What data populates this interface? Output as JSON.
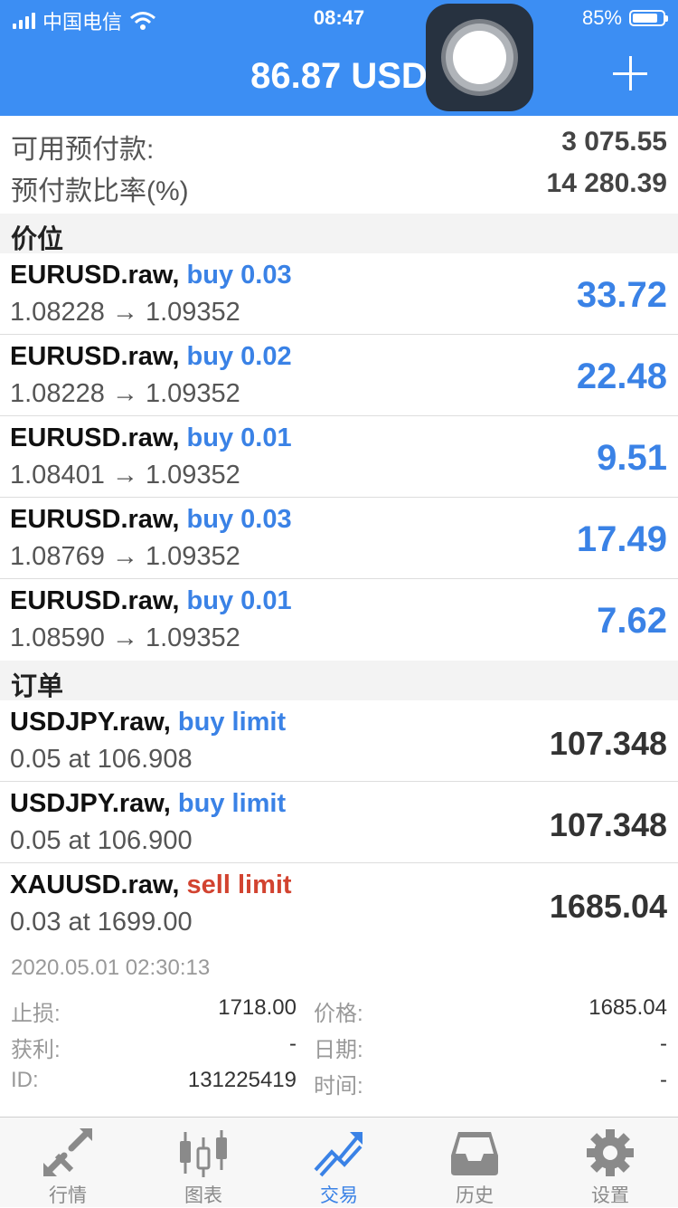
{
  "status_bar": {
    "carrier": "中国电信",
    "time": "08:47",
    "battery": "85%",
    "battery_level": 0.85
  },
  "header": {
    "title": "86.87 USD"
  },
  "summary": [
    {
      "label": "可用预付款:",
      "value": "3 075.55"
    },
    {
      "label": "预付款比率(%)",
      "value": "14 280.39"
    }
  ],
  "positions_header": "价位",
  "positions": [
    {
      "symbol": "EURUSD.raw,",
      "action": "buy 0.03",
      "prices": "1.08228 → 1.09352",
      "profit": "33.72"
    },
    {
      "symbol": "EURUSD.raw,",
      "action": "buy 0.02",
      "prices": "1.08228 → 1.09352",
      "profit": "22.48"
    },
    {
      "symbol": "EURUSD.raw,",
      "action": "buy 0.01",
      "prices": "1.08401 → 1.09352",
      "profit": "9.51"
    },
    {
      "symbol": "EURUSD.raw,",
      "action": "buy 0.03",
      "prices": "1.08769 → 1.09352",
      "profit": "17.49"
    },
    {
      "symbol": "EURUSD.raw,",
      "action": "buy 0.01",
      "prices": "1.08590 → 1.09352",
      "profit": "7.62"
    }
  ],
  "orders_header": "订单",
  "orders": [
    {
      "symbol": "USDJPY.raw,",
      "action": "buy limit",
      "detail": "0.05 at 106.908",
      "price": "107.348"
    },
    {
      "symbol": "USDJPY.raw,",
      "action": "buy limit",
      "detail": "0.05 at 106.900",
      "price": "107.348"
    },
    {
      "symbol": "XAUUSD.raw,",
      "action": "sell limit",
      "detail": "0.03 at 1699.00",
      "price": "1685.04"
    }
  ],
  "order_detail": {
    "timestamp": "2020.05.01 02:30:13",
    "stop_loss_label": "止损:",
    "stop_loss_value": "1718.00",
    "price_label": "价格:",
    "price_value": "1685.04",
    "take_profit_label": "获利:",
    "take_profit_value": "-",
    "date_label": "日期:",
    "date_value": "-",
    "id_label": "ID:",
    "id_value": "131225419",
    "time_label": "时间:",
    "time_value": "-"
  },
  "tabs": [
    {
      "label": "行情",
      "icon": "quotes-arrows-icon"
    },
    {
      "label": "图表",
      "icon": "candlestick-chart-icon"
    },
    {
      "label": "交易",
      "icon": "trade-trend-icon",
      "active": true
    },
    {
      "label": "历史",
      "icon": "history-inbox-icon"
    },
    {
      "label": "设置",
      "icon": "gear-icon"
    }
  ],
  "colors": {
    "accent": "#3c8ef3",
    "buy": "#3a82e6",
    "sell": "#d24330"
  }
}
